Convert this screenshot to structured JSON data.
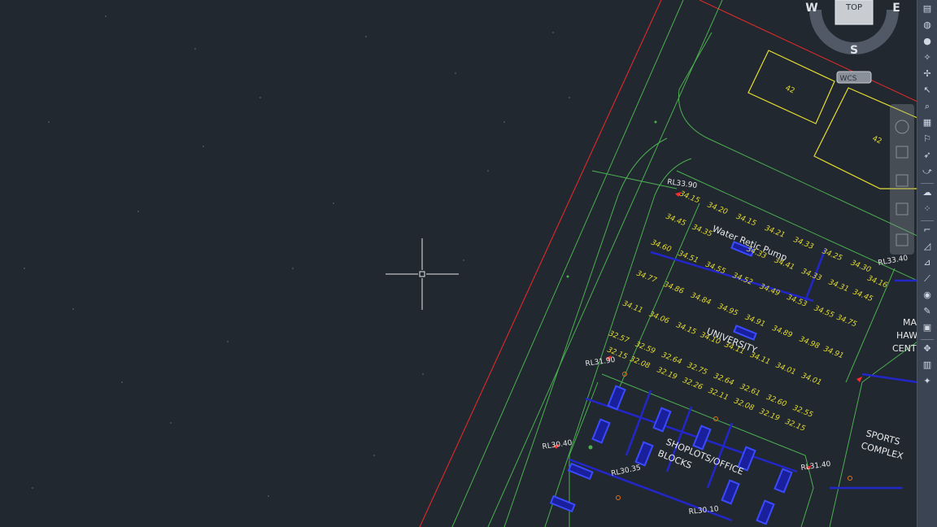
{
  "viewcube": {
    "top_label": "TOP",
    "west": "W",
    "east": "E",
    "south": "S",
    "ucs_label": "WCS"
  },
  "drawing": {
    "colors": {
      "background": "#212830",
      "boundary": "#d12a2a",
      "road": "#4caf50",
      "levels": "#e6dd30",
      "buildings": "#e6dd30",
      "utility": "#2326c8",
      "labels": "#e8e8e8"
    },
    "building_numbers": [
      "42",
      "42"
    ],
    "area_labels": {
      "pump": "Water Retic Pump",
      "university": "UNIVERSITY",
      "hawker_1": "MA",
      "hawker_2": "HAWK",
      "hawker_3": "CENT",
      "sports_1": "SPORTS",
      "sports_2": "COMPLEX",
      "shoplots_1": "SHOPLOTS/OFFICE",
      "shoplots_2": "BLOCKS"
    },
    "rl_labels": [
      "RL33.90",
      "RL33.40",
      "RL31.90",
      "RL30.40",
      "RL30.35",
      "RL31.40",
      "RL30.10"
    ],
    "spot_levels": [
      "34.15",
      "34.20",
      "34.15",
      "34.21",
      "34.33",
      "34.25",
      "34.30",
      "34.16",
      "34.45",
      "34.35",
      "34.33",
      "34.41",
      "34.33",
      "34.31",
      "34.45",
      "34.60",
      "34.51",
      "34.55",
      "34.52",
      "34.49",
      "34.53",
      "34.55",
      "34.75",
      "34.77",
      "34.86",
      "34.84",
      "34.95",
      "34.91",
      "34.89",
      "34.98",
      "34.91",
      "34.11",
      "34.06",
      "34.15",
      "34.10",
      "34.11",
      "34.11",
      "34.01",
      "34.01",
      "32.57",
      "32.59",
      "32.64",
      "32.75",
      "32.64",
      "32.61",
      "32.60",
      "32.55",
      "32.15",
      "32.08",
      "32.19",
      "32.26",
      "32.11",
      "32.08",
      "32.19",
      "32.15"
    ]
  },
  "toolbar": {
    "tools": [
      {
        "icon": "layer-properties-icon",
        "glyph": "▤"
      },
      {
        "icon": "globe-icon",
        "glyph": "◍"
      },
      {
        "icon": "earth-icon",
        "glyph": "●"
      },
      {
        "icon": "snap-icon",
        "glyph": "✧"
      },
      {
        "icon": "pin-icon",
        "glyph": "✢"
      },
      {
        "icon": "select-cursor-icon",
        "glyph": "↖"
      },
      {
        "icon": "zoom-object-icon",
        "glyph": "⌕"
      },
      {
        "icon": "table-icon",
        "glyph": "▦"
      },
      {
        "icon": "flag-icon",
        "glyph": "⚐"
      },
      {
        "icon": "pointer-icon",
        "glyph": "➶"
      },
      {
        "icon": "hook-icon",
        "glyph": "⤻"
      },
      {
        "icon": "cloud-icon",
        "glyph": "☁"
      },
      {
        "icon": "snap-points-icon",
        "glyph": "⁘"
      },
      {
        "icon": "corner-icon",
        "glyph": "⌐"
      },
      {
        "icon": "triangle-icon",
        "glyph": "◿"
      },
      {
        "icon": "chart-icon",
        "glyph": "⊿"
      },
      {
        "icon": "line-icon",
        "glyph": "⟋"
      },
      {
        "icon": "ball-icon",
        "glyph": "◉"
      },
      {
        "icon": "pen-icon",
        "glyph": "✎"
      },
      {
        "icon": "calculator-icon",
        "glyph": "▣"
      },
      {
        "icon": "select-similar-icon",
        "glyph": "✥"
      },
      {
        "icon": "grid-icon",
        "glyph": "▥"
      },
      {
        "icon": "star-icon",
        "glyph": "✦"
      }
    ]
  }
}
